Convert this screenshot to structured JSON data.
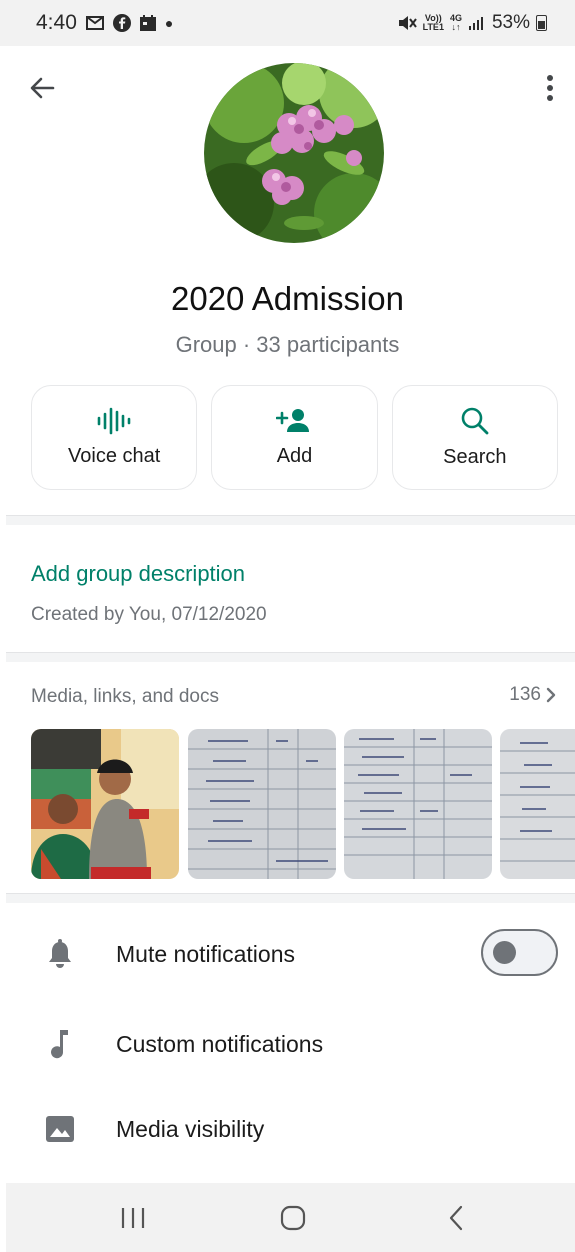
{
  "status_bar": {
    "time": "4:40",
    "network_top": "Vo))",
    "network_bottom": "LTE1",
    "data_top": "4G",
    "data_bottom": "↓↑",
    "battery": "53%"
  },
  "group": {
    "name": "2020 Admission",
    "subtitle": "Group · 33 participants"
  },
  "actions": [
    {
      "label": "Voice chat",
      "icon": "voice-wave-icon"
    },
    {
      "label": "Add",
      "icon": "add-person-icon"
    },
    {
      "label": "Search",
      "icon": "search-icon"
    }
  ],
  "description": {
    "link": "Add group description",
    "created": "Created by You, 07/12/2020"
  },
  "media": {
    "label": "Media, links, and docs",
    "count": "136"
  },
  "settings": [
    {
      "label": "Mute notifications",
      "icon": "bell-icon",
      "toggle": false
    },
    {
      "label": "Custom notifications",
      "icon": "music-note-icon"
    },
    {
      "label": "Media visibility",
      "icon": "image-icon"
    }
  ],
  "colors": {
    "accent": "#008069",
    "muted": "#6f7378"
  }
}
